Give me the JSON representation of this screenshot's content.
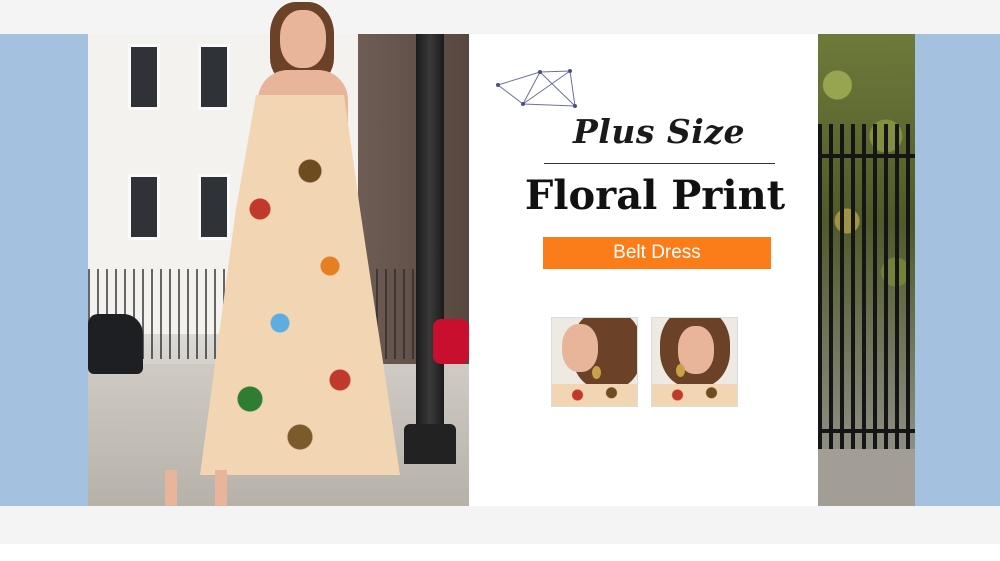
{
  "banner": {
    "subtitle": "Plus Size",
    "title": "Floral Print",
    "tag": "Belt Dress"
  },
  "colors": {
    "accent": "#fa7d1a",
    "side_panel": "#a4c2e0",
    "band": "#f4f4f4",
    "text": "#111111"
  },
  "thumbnails": [
    {
      "name": "model side profile detail"
    },
    {
      "name": "model front neckline detail"
    }
  ]
}
